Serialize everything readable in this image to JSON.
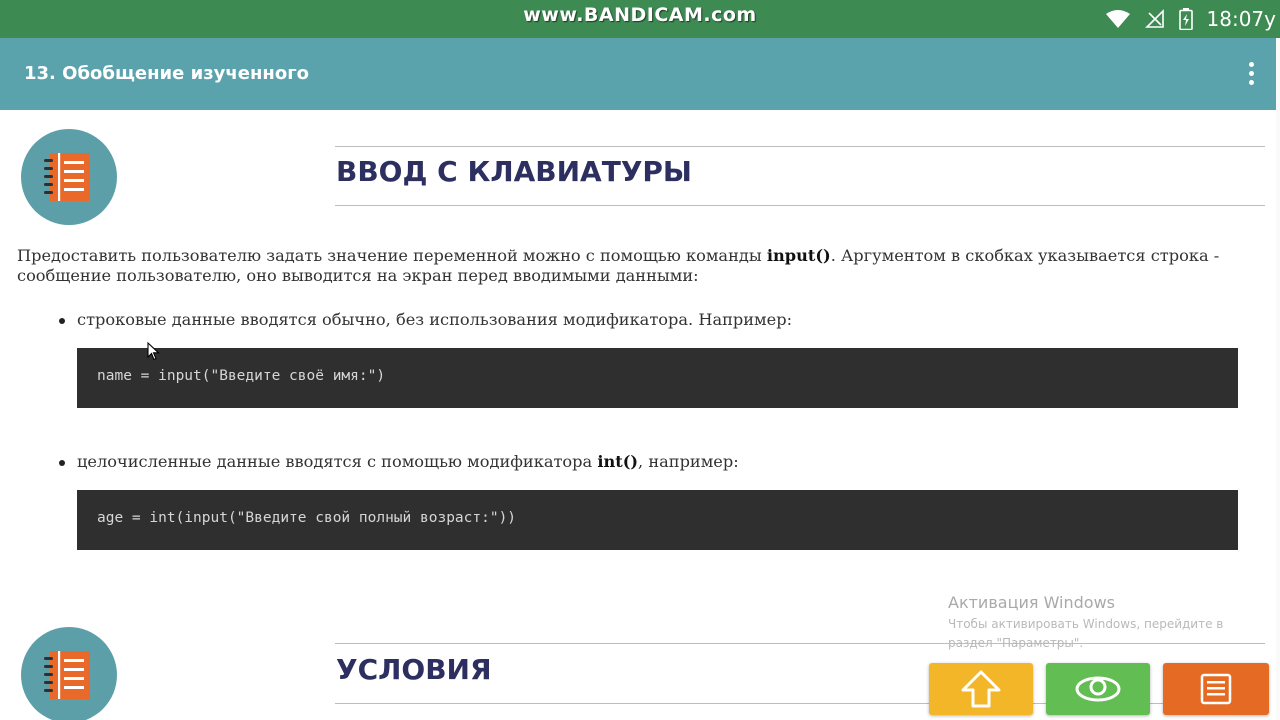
{
  "status_bar": {
    "watermark": "www.BANDICAM.com",
    "time": "18:07",
    "time_suffix": "у",
    "icons": [
      "wifi-icon",
      "no-signal-icon",
      "battery-charging-icon"
    ]
  },
  "app_bar": {
    "title": "13. Обобщение изученного",
    "menu_icon": "more-vert-icon"
  },
  "sections": [
    {
      "title": "ВВОД С КЛАВИАТУРЫ",
      "icon": "notebook-icon"
    },
    {
      "title": "УСЛОВИЯ",
      "icon": "notebook-icon"
    }
  ],
  "content": {
    "paragraph": {
      "part1": "Предоставить пользователю задать значение переменной можно с помощью команды ",
      "command": "input()",
      "part2": ". Аргументом в скобках указывается строка - сообщение пользователю, оно выводится на экран перед вводимыми данными:"
    },
    "bullets": [
      {
        "text": "строковые данные вводятся обычно, без использования модификатора. Например:"
      },
      {
        "before": "целочисленные данные вводятся с помощью модификатора ",
        "bold": "int()",
        "after": ", например:"
      }
    ],
    "code_blocks": [
      "name = input(\"Введите своё имя:\")",
      "age = int(input(\"Введите свой полный возраст:\"))"
    ]
  },
  "activation": {
    "title": "Активация Windows",
    "subtitle": "Чтобы активировать Windows, перейдите в раздел \"Параметры\"."
  },
  "bottom_buttons": [
    {
      "icon": "arrow-up-icon",
      "color": "#f3b629"
    },
    {
      "icon": "eye-icon",
      "color": "#62bd52"
    },
    {
      "icon": "list-icon",
      "color": "#e56b24"
    }
  ],
  "colors": {
    "status_bar": "#3d8a52",
    "app_bar": "#5aa3ad",
    "heading": "#2c2f5f",
    "code_bg": "#2f2f2f"
  }
}
